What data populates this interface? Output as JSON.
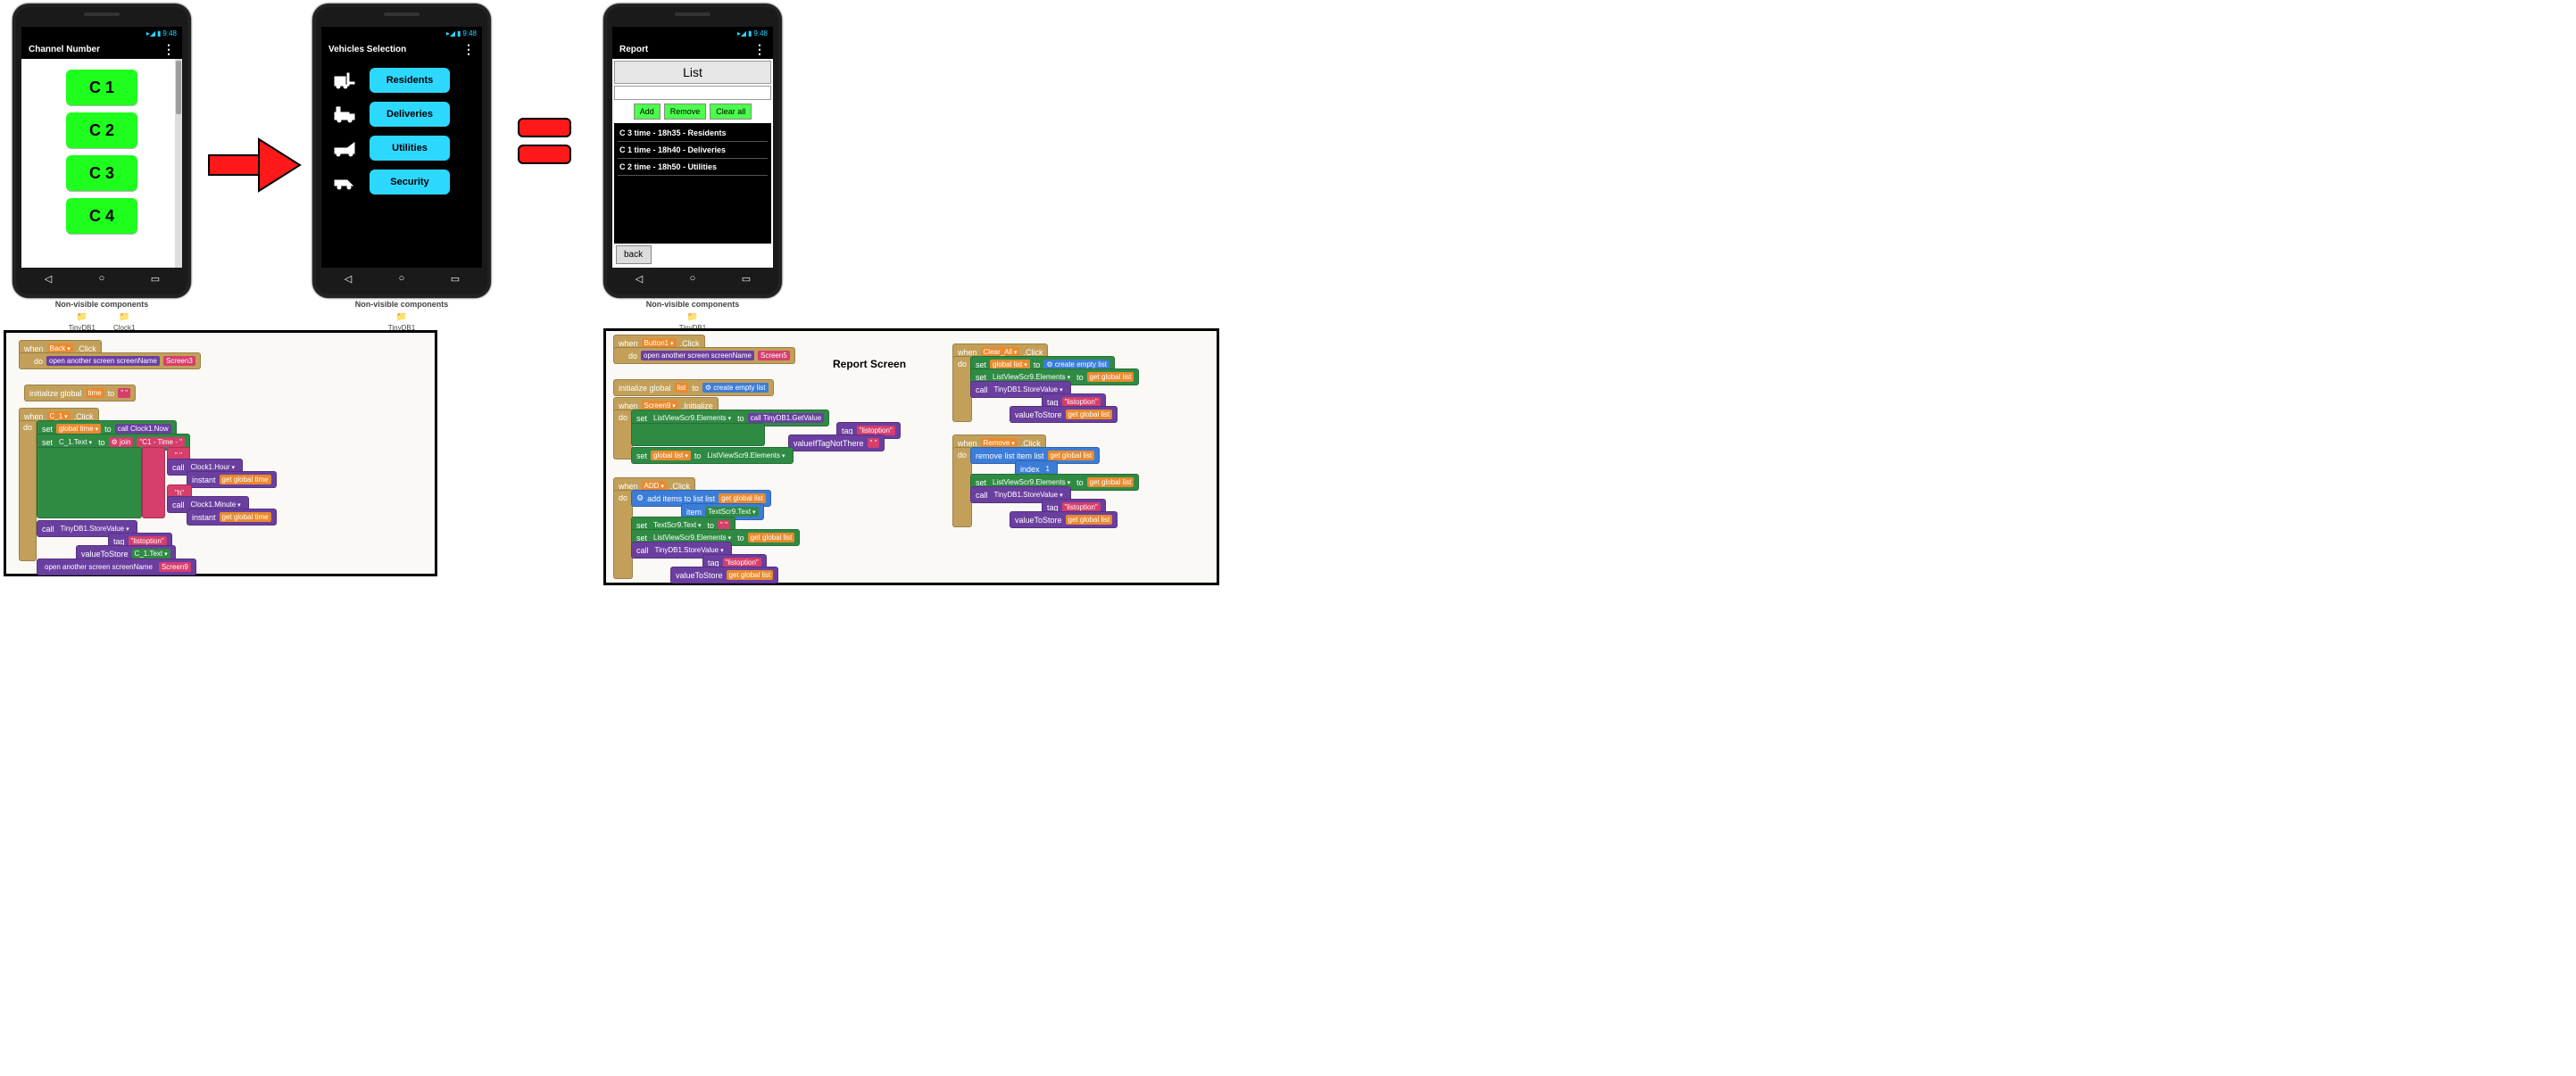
{
  "status_time": "9:48",
  "phones": {
    "channel": {
      "title": "Channel Number",
      "buttons": [
        "C 1",
        "C 2",
        "C 3",
        "C 4"
      ]
    },
    "vehicles": {
      "title": "Vehicles Selection",
      "rows": [
        {
          "icon": "forklift",
          "label": "Residents"
        },
        {
          "icon": "truck",
          "label": "Deliveries"
        },
        {
          "icon": "tow",
          "label": "Utilities"
        },
        {
          "icon": "van",
          "label": "Security"
        }
      ]
    },
    "report": {
      "title": "Report",
      "list_title": "List",
      "add": "Add",
      "remove": "Remove",
      "clear": "Clear all",
      "items": [
        "C 3 time - 18h35 - Residents",
        "C 1 time - 18h40 - Deliveries",
        "C 2 time - 18h50 - Utilities"
      ],
      "back": "back"
    }
  },
  "nonvisible_label": "Non-visible components",
  "nv1": [
    "TinyDB1",
    "Clock1"
  ],
  "nv2": [
    "TinyDB1"
  ],
  "nv3": [
    "TinyDB1"
  ],
  "report_screen_heading": "Report Screen",
  "blocks_left": {
    "backclick_event": "when",
    "backclick_target": "Back",
    "backclick_evt": ".Click",
    "openscreen": "open another screen  screenName",
    "screen3": "Screen3",
    "initglobal": "initialize global",
    "timevar": "time",
    "to": "to",
    "emptytext": "\" \"",
    "c1click_event": "when",
    "c1target": "C_1",
    "c1evt": ".Click",
    "do": "do",
    "setglobaltime": "set",
    "globaltime": "global time",
    "callclocknow": "call",
    "clock1": "Clock1",
    "now": ".Now",
    "setc1text": "set",
    "c1": "C_1",
    "textprop": ".Text",
    "join": "join",
    "c1textlit": "\"C1 - Time - \"",
    "sep": "\" \"",
    "callhour": "call",
    "clock1h": "Clock1",
    "hourprop": ".Hour",
    "instant": "instant",
    "getgt1": "get",
    "gtfield": "global time",
    "hsep": "\"h\"",
    "callmin": "call",
    "clock1m": "Clock1",
    "minprop": ".Minute",
    "getgt2": "get",
    "calldb": "call",
    "tinydb": "TinyDB1",
    "store": ".StoreValue",
    "tag": "tag",
    "listoption": "\"listoption\"",
    "vts": "valueToStore",
    "c1text": "C_1",
    "textprop2": ".Text",
    "openscreen9": "open another screen  screenName",
    "screen9": "Screen9"
  },
  "blocks_right": {
    "btn1_when": "when",
    "btn1": "Button1",
    "btn1evt": ".Click",
    "open5": "open another screen  screenName",
    "screen5": "Screen5",
    "initlist": "initialize global",
    "listvar": "list",
    "createempty": "create empty list",
    "scr9_when": "when",
    "scr9": "Screen9",
    "init": ".Initialize",
    "setlv": "set",
    "lv": "ListViewScr9",
    "elem": ".Elements",
    "callgv": "call",
    "tdb": "TinyDB1",
    "gv": ".GetValue",
    "tag": "tag",
    "listoption": "\"listoption\"",
    "vint": "valueIfTagNotThere",
    "emptytext": "\" \"",
    "setgl": "set",
    "gl": "global list",
    "lv2": "ListViewScr9",
    "elem2": ".Elements",
    "add_when": "when",
    "addbtn": "ADD",
    "addevt": ".Click",
    "additems": "add items to list  list",
    "getgl": "get",
    "glf": "global list",
    "item": "item",
    "txtscr": "TextScr9",
    "txtprop": ".Text",
    "settxt": "set",
    "txtscr2": "TextScr9",
    "txtprop2": ".Text",
    "empty": "\" \"",
    "setlv2": "set",
    "lv3": "ListViewScr9",
    "elem3": ".Elements",
    "getgl2": "get",
    "calldb": "call",
    "tdb2": "TinyDB1",
    "store": ".StoreValue",
    "tag2": "tag",
    "vts": "valueToStore",
    "getgl3": "get",
    "clear_when": "when",
    "clear": "Clear_All",
    "clearevt": ".Click",
    "setgl_e": "set",
    "createempty2": "create empty list",
    "setlv_e": "set",
    "getgl_e": "get",
    "calldb_e": "call",
    "tdb3": "TinyDB1",
    "store2": ".StoreValue",
    "tag3": "tag",
    "vts2": "valueToStore",
    "getgl_e2": "get",
    "rem_when": "when",
    "rem": "Remove",
    "remevt": ".Click",
    "remitem": "remove list item  list",
    "getgl_r": "get",
    "index": "index",
    "one": "1",
    "setlv_r": "set",
    "getgl_r2": "get",
    "calldb_r": "call",
    "tdb4": "TinyDB1",
    "store3": ".StoreValue",
    "tag4": "tag",
    "vts3": "valueToStore",
    "getgl_r3": "get"
  }
}
